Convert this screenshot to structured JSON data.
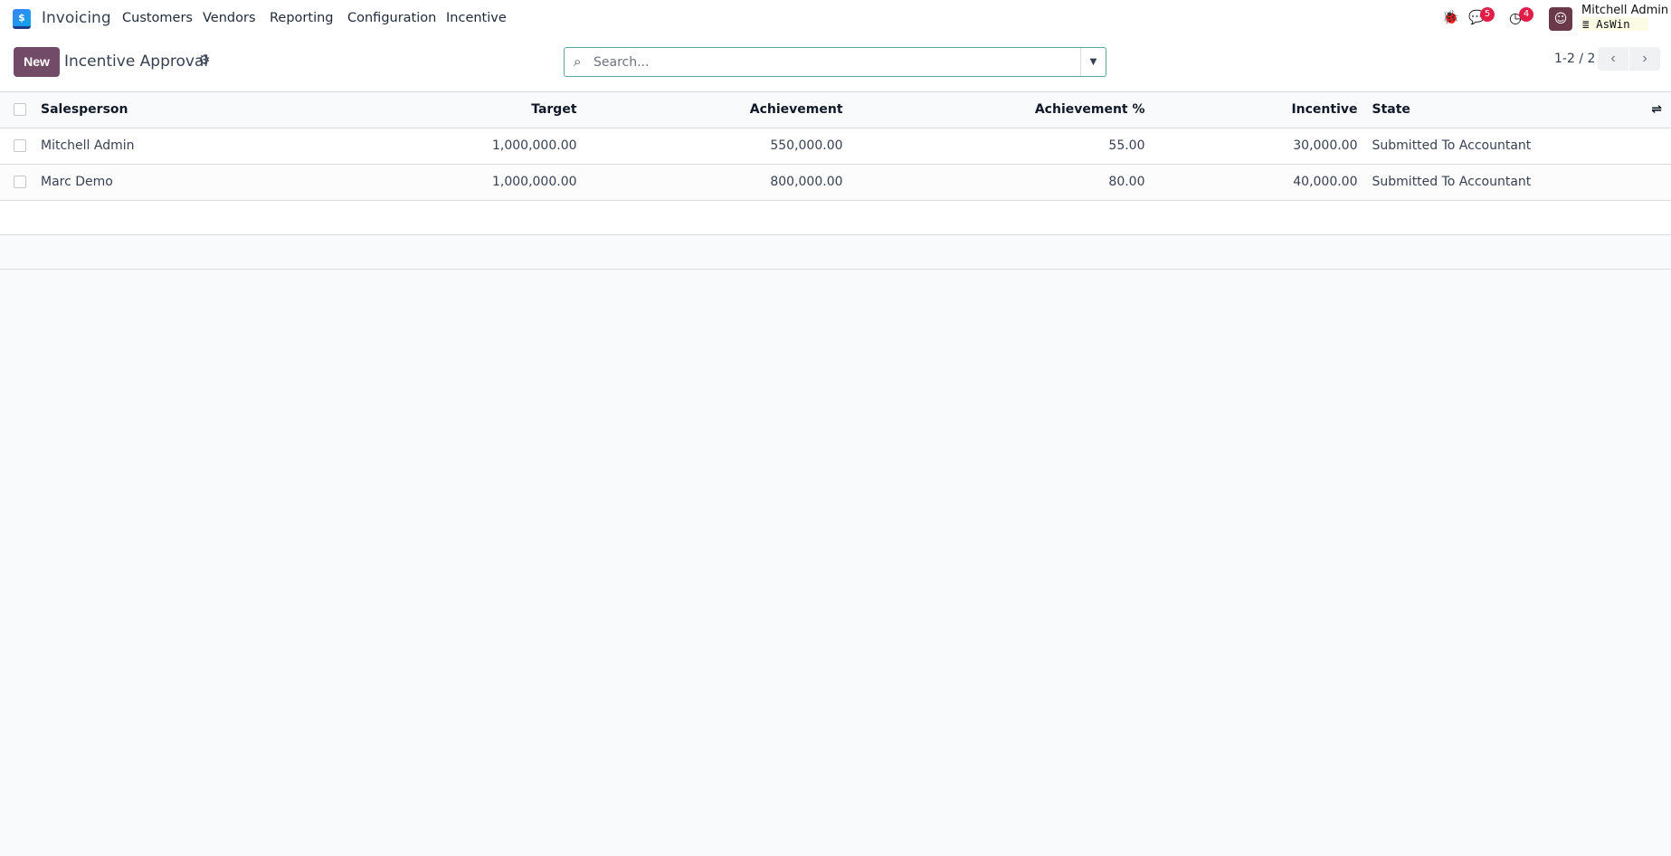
{
  "nav": {
    "app": "Invoicing",
    "menu": [
      "Customers",
      "Vendors",
      "Reporting",
      "Configuration",
      "Incentive"
    ],
    "messages_count": "5",
    "activities_count": "4",
    "user": "Mitchell Admin",
    "database": "AsWin"
  },
  "control": {
    "new_label": "New",
    "title": "Incentive Approval",
    "search_placeholder": "Search...",
    "pager": "1-2 / 2"
  },
  "table": {
    "headers": [
      "Salesperson",
      "Target",
      "Achievement",
      "Achievement %",
      "Incentive",
      "State"
    ],
    "rows": [
      [
        "Mitchell Admin",
        "1,000,000.00",
        "550,000.00",
        "55.00",
        "30,000.00",
        "Submitted To Accountant"
      ],
      [
        "Marc Demo",
        "1,000,000.00",
        "800,000.00",
        "80.00",
        "40,000.00",
        "Submitted To Accountant"
      ]
    ]
  },
  "colors": {
    "brand": "#714b67",
    "badge": "#e11d48",
    "search_border": "#58a7a1"
  }
}
